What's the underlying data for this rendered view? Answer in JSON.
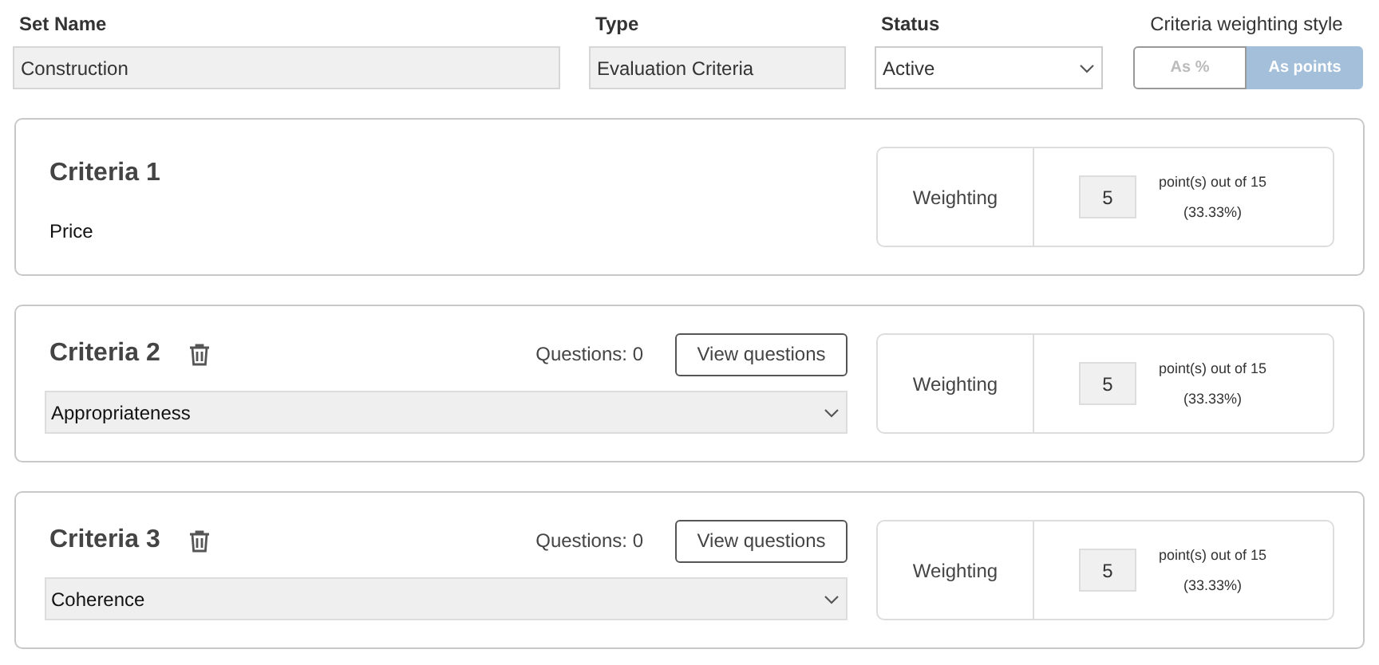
{
  "header": {
    "set_name": {
      "label": "Set Name",
      "value": "Construction"
    },
    "type": {
      "label": "Type",
      "value": "Evaluation Criteria"
    },
    "status": {
      "label": "Status",
      "value": "Active"
    },
    "weighting_style": {
      "label": "Criteria weighting style",
      "options": [
        {
          "label": "As %",
          "selected": false
        },
        {
          "label": "As points",
          "selected": true
        }
      ]
    }
  },
  "criteria": [
    {
      "kind": "fixed",
      "title": "Criteria 1",
      "name": "Price",
      "weighting_label": "Weighting",
      "points": "5",
      "points_text": "point(s) out of 15",
      "percent": "(33.33%)"
    },
    {
      "kind": "select",
      "title": "Criteria 2",
      "name": "Appropriateness",
      "questions": "Questions: 0",
      "view_button": "View questions",
      "weighting_label": "Weighting",
      "points": "5",
      "points_text": "point(s) out of 15",
      "percent": "(33.33%)"
    },
    {
      "kind": "select",
      "title": "Criteria 3",
      "name": "Coherence",
      "questions": "Questions: 0",
      "view_button": "View questions",
      "weighting_label": "Weighting",
      "points": "5",
      "points_text": "point(s) out of 15",
      "percent": "(33.33%)"
    }
  ]
}
